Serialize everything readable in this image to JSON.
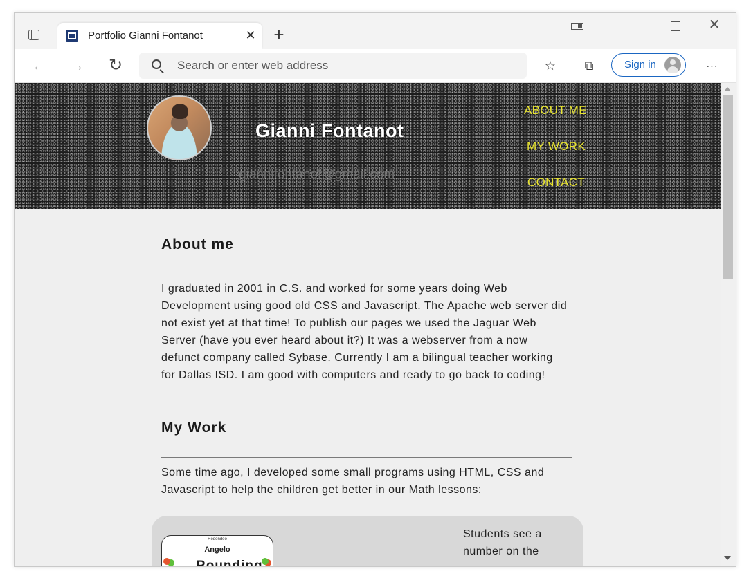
{
  "browser": {
    "tab": {
      "title": "Portfolio Gianni Fontanot"
    },
    "address": {
      "placeholder": "Search or enter web address"
    },
    "signin_label": "Sign in"
  },
  "header": {
    "name": "Gianni Fontanot",
    "email": "giannifontanot@gmail.com",
    "nav": [
      {
        "label": "ABOUT ME"
      },
      {
        "label": "MY WORK"
      },
      {
        "label": "CONTACT"
      }
    ]
  },
  "about": {
    "title": "About me",
    "text": "I graduated in 2001 in C.S. and worked for some years doing Web Development using good old CSS and Javascript. The Apache web server did not exist yet at that time! To publish our pages we used the Jaguar Web Server (have you ever heard about it?) It was a webserver from a now defunct company called Sybase. Currently I am a bilingual teacher working for Dallas ISD. I am good with computers and ready to go back to coding!"
  },
  "work": {
    "title": "My Work",
    "text": "Some time ago, I developed some small programs using HTML, CSS and Javascript to help the children get better in our Math lessons:",
    "projects": [
      {
        "title": "Rounding",
        "description": "Students see a number on the",
        "thumb_small": "Redondeo",
        "thumb_name": "Angelo"
      }
    ]
  },
  "colors": {
    "nav_link": "#e8e430",
    "header_bg": "#1c1c1c",
    "page_bg": "#efefef",
    "accent": "#1a66c2"
  }
}
